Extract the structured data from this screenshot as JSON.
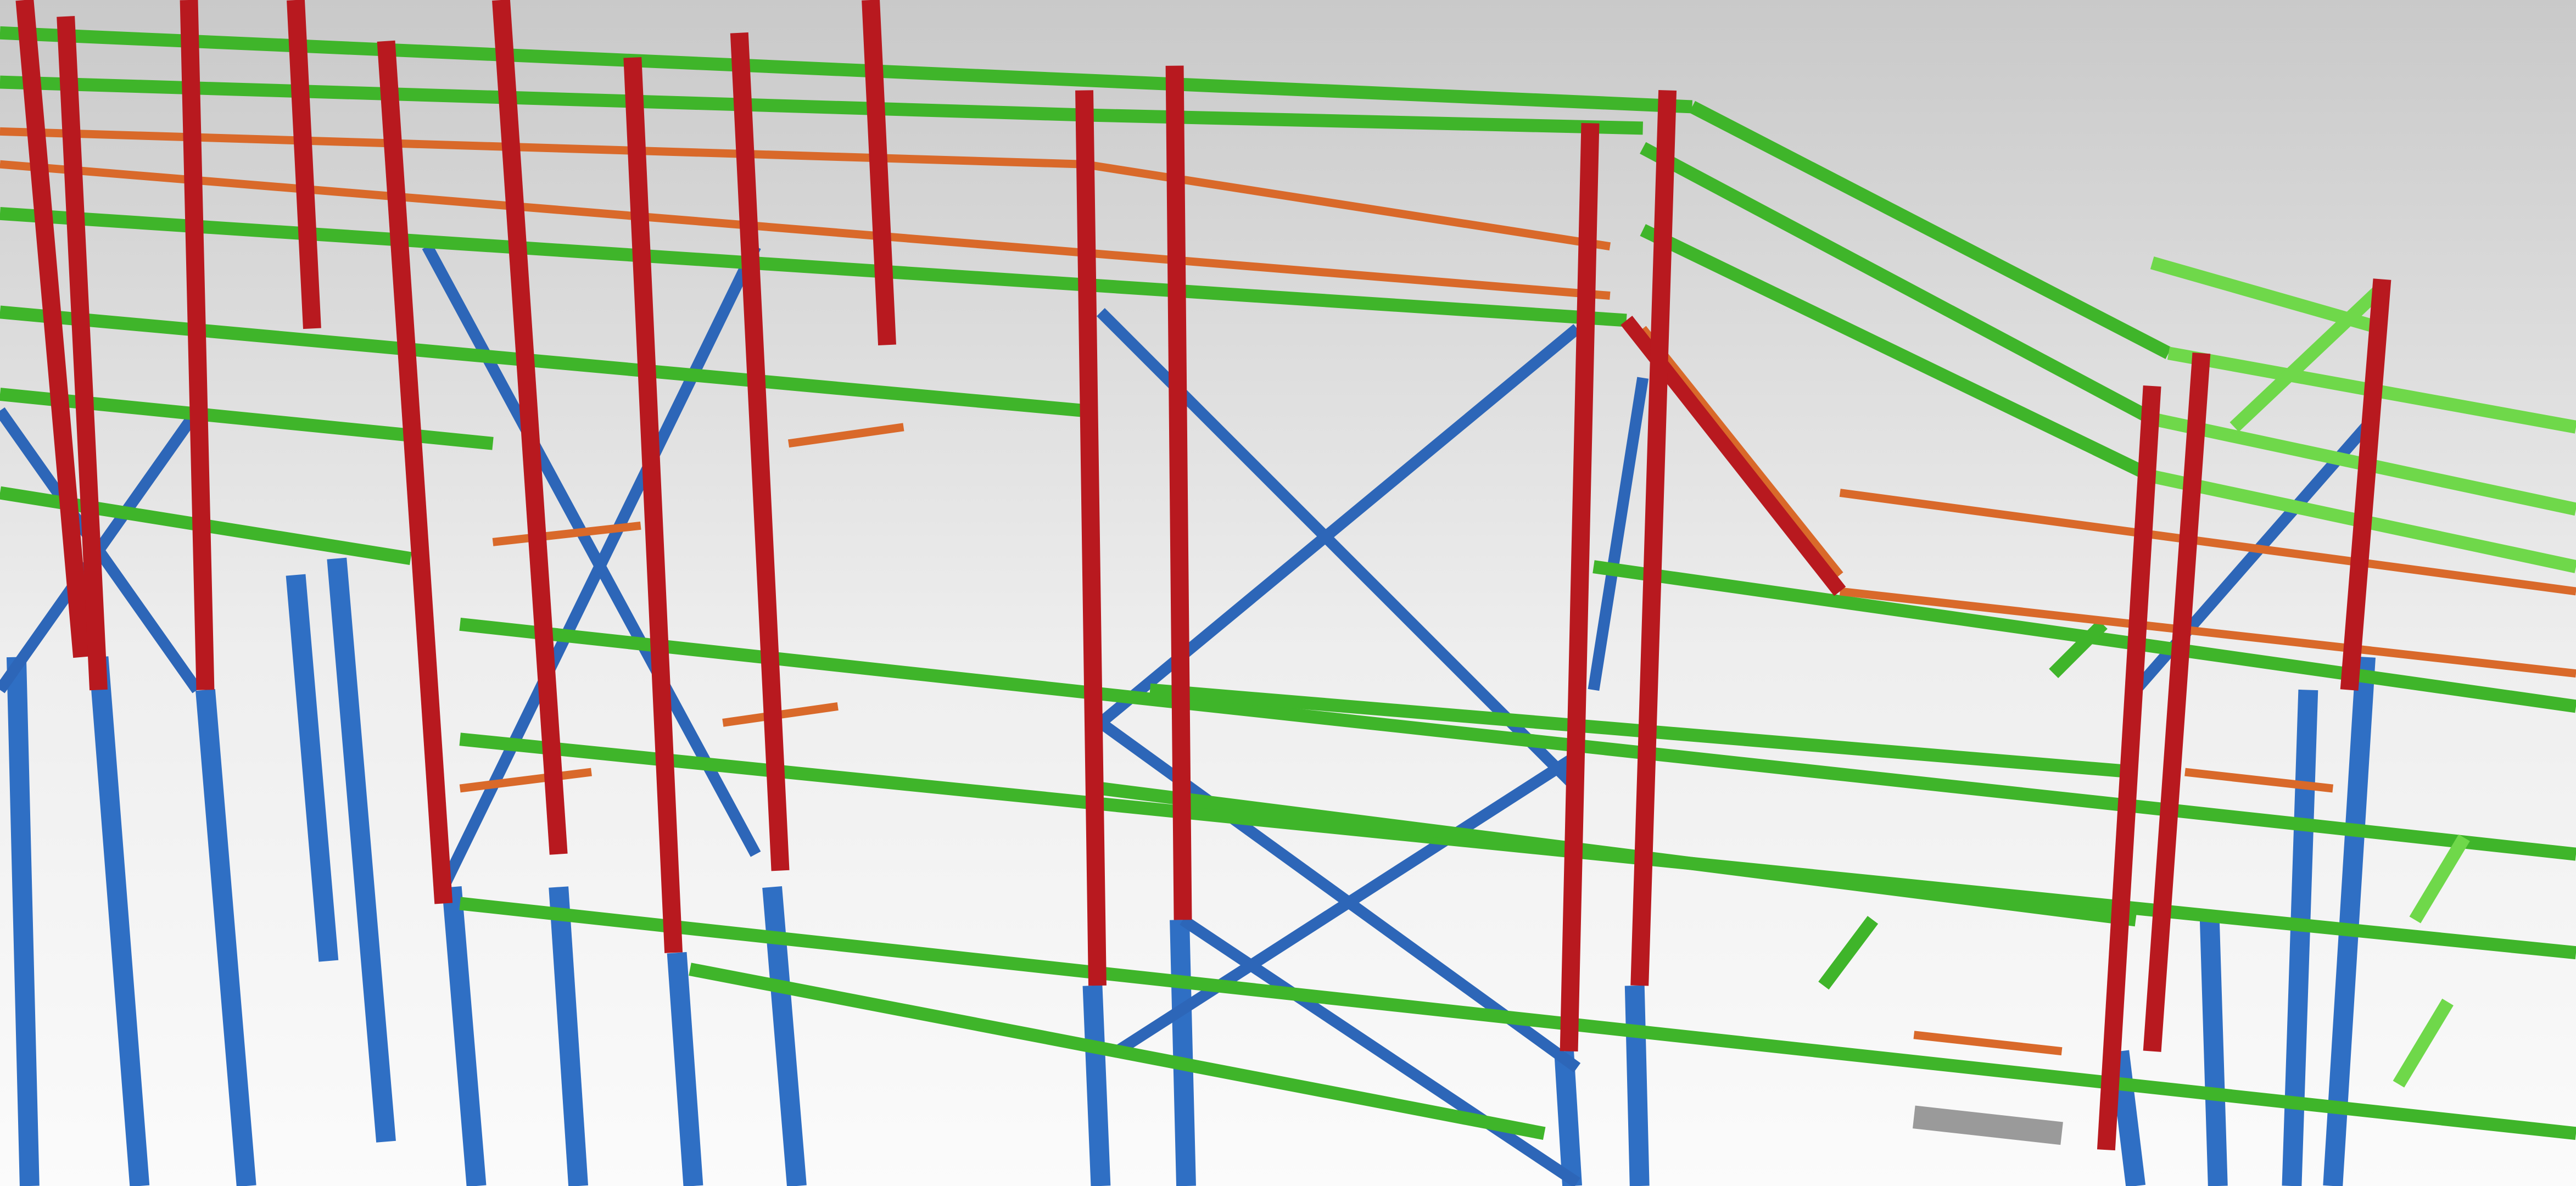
{
  "scene": {
    "subject": "steel-structure-render",
    "colors": {
      "sky_top": "#c9c9c9",
      "sky_bottom": "#fbfbfb",
      "column_red": "#b8191f",
      "column_blue": "#2f6fc4",
      "beam_green": "#3fb52a",
      "beam_green_light": "#6fd84a",
      "brace_blue": "#2d66b8",
      "railing_orange": "#d9692a",
      "grating_gray": "#9a9a9a"
    }
  }
}
